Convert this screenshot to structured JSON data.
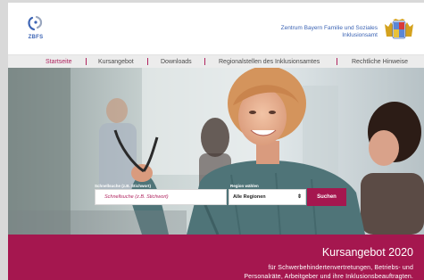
{
  "header": {
    "logo_text": "ZBFS",
    "org_line1": "Zentrum Bayern Familie und Soziales",
    "org_line2": "Inklusionsamt"
  },
  "nav": {
    "items": [
      "Startseite",
      "Kursangebot",
      "Downloads",
      "Regionalstellen des Inklusionsamtes",
      "Rechtliche Hinweise"
    ],
    "active_index": 0
  },
  "search": {
    "label": "Schnellsuche (z.B. Stichwort)",
    "placeholder": "Schnellsuche (z.B. Stichwort)",
    "region_label": "Region wählen",
    "region_value": "Alle Regionen",
    "button_label": "Suchen"
  },
  "banner": {
    "title": "Kursangebot 2020",
    "subtitle_line1": "für Schwerbehindertenvertretungen, Betriebs- und",
    "subtitle_line2": "Personalräte, Arbeitgeber und ihre Inklusionsbeauftragten."
  },
  "colors": {
    "brand": "#a5174f",
    "nav_active": "#b0245f",
    "logo_blue": "#3c64b4"
  }
}
